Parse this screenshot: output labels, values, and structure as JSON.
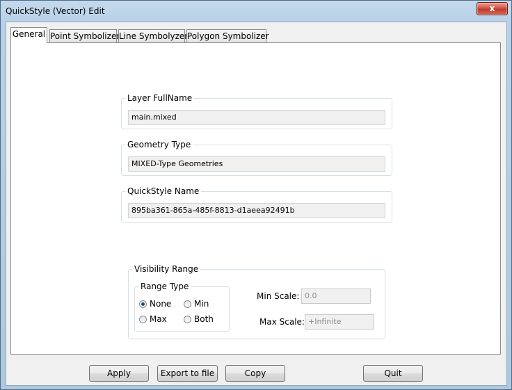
{
  "window": {
    "title": "QuickStyle (Vector) Edit",
    "close_label": "x"
  },
  "tabs": [
    "General",
    "Point Symbolizer",
    "Line Symbolyzer",
    "Polygon Symbolizer"
  ],
  "general": {
    "layer_fullname": {
      "label": "Layer FullName",
      "value": "main.mixed"
    },
    "geometry_type": {
      "label": "Geometry Type",
      "value": "MIXED-Type Geometries"
    },
    "quickstyle_name": {
      "label": "QuickStyle Name",
      "value": "895ba361-865a-485f-8813-d1aeea92491b"
    },
    "visibility": {
      "label": "Visibility Range",
      "range_type_label": "Range Type",
      "options": [
        "None",
        "Min",
        "Max",
        "Both"
      ],
      "selected": "None",
      "min_scale_label": "Min Scale:",
      "min_scale_value": "0.0",
      "max_scale_label": "Max Scale:",
      "max_scale_value": "+Infinite"
    }
  },
  "buttons": {
    "apply": "Apply",
    "export": "Export to file",
    "copy": "Copy",
    "quit": "Quit"
  }
}
